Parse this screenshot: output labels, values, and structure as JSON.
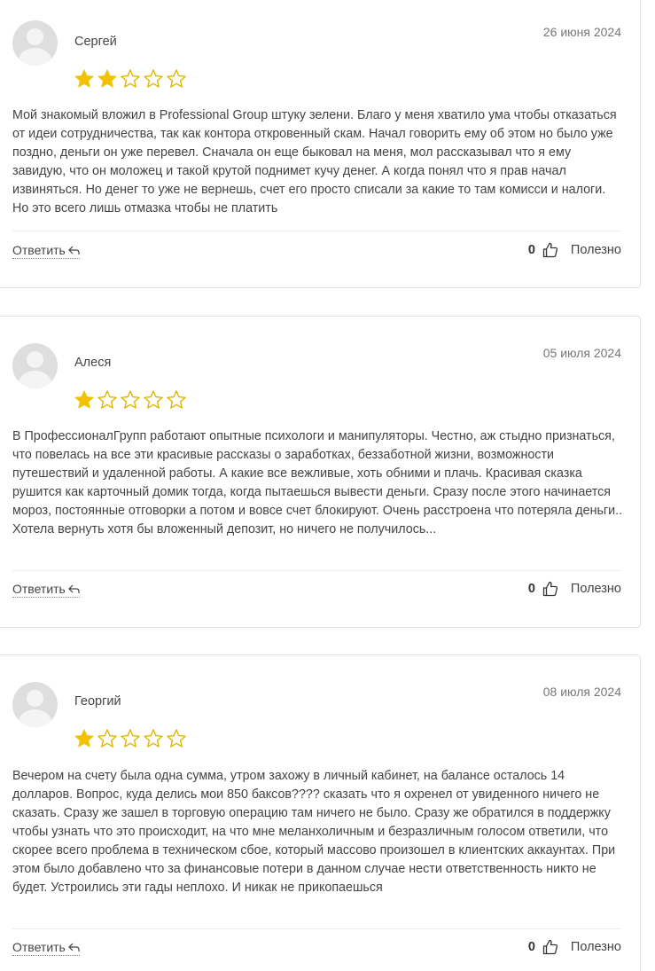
{
  "reviews": [
    {
      "author": "Сергей",
      "date": "26 июня 2024",
      "rating": 2,
      "text": "Мой знакомый вложил в Professional Group штуку зелени. Благо у меня хватило ума чтобы отказаться от идеи сотрудничества, так как контора откровенный скам. Начал говорить ему об этом но было уже поздно, деньги он уже перевел. Сначала он еще быковал на меня, мол рассказывал что я ему завидую, что он моложец и такой крутой поднимет кучу денег. А когда понял что я прав начал извиняться. Но денег то уже не вернешь, счет его просто списали за какие то там комисси и налоги. Но это всего лишь отмазка чтобы не платить",
      "reply_label": "Ответить",
      "likes": "0",
      "useful_label": "Полезно"
    },
    {
      "author": "Алеся",
      "date": "05 июля 2024",
      "rating": 1,
      "text": "В ПрофессионалГрупп работают опытные психологи и манипуляторы. Честно, аж стыдно признаться, что повелась на все эти красивые рассказы о заработках, беззаботной жизни, возможности путешествий и удаленной работы. А какие все вежливые, хоть обними и плачь. Красивая сказка рушится как карточный домик тогда, когда пытаешься вывести деньги. Сразу после этого начинается мороз, постоянные отговорки а потом и вовсе счет блокируют. Очень расстроена что потеряла деньги.. Хотела вернуть хотя бы вложенный депозит, но ничего не получилось...",
      "reply_label": "Ответить",
      "likes": "0",
      "useful_label": "Полезно"
    },
    {
      "author": "Георгий",
      "date": "08 июля 2024",
      "rating": 1,
      "text": "Вечером на счету была одна сумма, утром захожу в личный кабинет, на балансе осталось 14 долларов. Вопрос, куда делись мои 850 баксов???? сказать что я охренел от увиденного ничего не сказать. Сразу же зашел в торговую операцию там ничего не было. Сразу же обратился в поддержку чтобы узнать что это происходит, на что мне меланхоличным и безразличным голосом ответили, что скорее всего проблема в техническом сбое, который массово произошел в клиентских аккаунтах. При этом было добавлено что за финансовые потери в данном случае нести ответственность никто не будет. Устроились эти гады неплохо. И никак не прикопаешься",
      "reply_label": "Ответить",
      "likes": "0",
      "useful_label": "Полезно"
    }
  ],
  "colors": {
    "star_filled": "#f2c200",
    "star_empty_stroke": "#e0b600",
    "border": "#e4e4e4",
    "text": "#444444",
    "date": "#777777"
  },
  "icons": {
    "avatar": "user-placeholder-icon",
    "star": "star-icon",
    "reply": "reply-arrow-icon",
    "like": "thumbs-up-icon"
  }
}
